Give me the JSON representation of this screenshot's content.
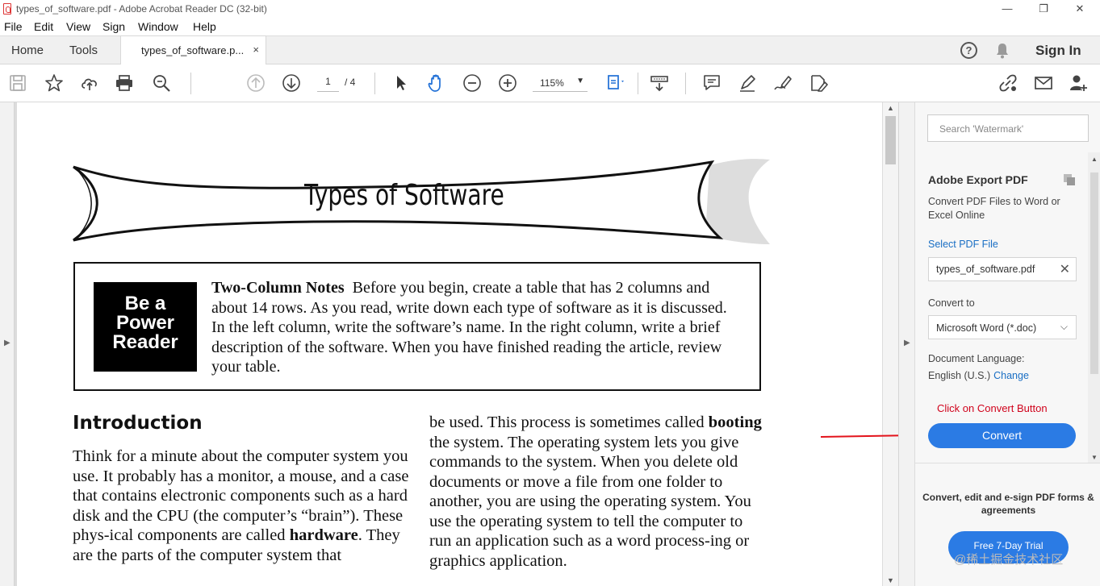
{
  "window": {
    "title": "types_of_software.pdf - Adobe Acrobat Reader DC (32-bit)",
    "minimize": "—",
    "maximize": "❐",
    "close": "✕"
  },
  "menu": [
    "File",
    "Edit",
    "View",
    "Sign",
    "Window",
    "Help"
  ],
  "tabs": {
    "home": "Home",
    "tools": "Tools",
    "document": "types_of_software.p...",
    "close": "×",
    "help": "?",
    "sign_in": "Sign In"
  },
  "toolbar": {
    "page_current": "1",
    "page_total": "/ 4",
    "zoom": "115%",
    "zoom_caret": "▼"
  },
  "document": {
    "banner_title": "Types of Software",
    "badge_lines": [
      "Be a",
      "Power",
      "Reader"
    ],
    "notes_heading": "Two-Column Notes",
    "notes_body": "Before you begin, create a table that has 2 columns and about 14 rows. As you read, write down each type of software as it is discussed. In the left column, write the software’s name. In the right column, write a brief description of the software. When you have finished reading the article, review your table.",
    "intro_heading": "Introduction",
    "left_col_a": "Think for a minute about the computer system you use. It probably has a monitor, a mouse, and a case that contains electronic components such as a hard disk and the CPU (the computer’s “brain”). These phys-ical components are called ",
    "left_col_bold": "hardware",
    "left_col_b": ". They are the parts of the computer system that",
    "right_col_a": "be used. This process is sometimes called ",
    "right_col_bold": "booting",
    "right_col_b": " the system. The operating system lets you give commands to the system. When you delete old documents or move a file from one folder to another, you are using the operating system. You use the operating system to tell the computer to run an application such as a word process-ing or graphics application."
  },
  "right_panel": {
    "search_placeholder": "Search 'Watermark'",
    "export_title": "Adobe Export PDF",
    "export_desc": "Convert PDF Files to Word or Excel Online",
    "select_file": "Select PDF File",
    "file_name": "types_of_software.pdf",
    "file_clear": "✕",
    "convert_to": "Convert to",
    "format": "Microsoft Word (*.doc)",
    "format_caret": "⌵",
    "doc_language": "Document Language:",
    "language": "English (U.S.)",
    "change": "Change",
    "annotation": "Click on Convert Button",
    "convert_button": "Convert",
    "promo": "Convert, edit and e-sign PDF forms & agreements",
    "trial_button": "Free 7-Day Trial",
    "watermark": "@稀土掘金技术社区"
  },
  "colors": {
    "accent": "#2b7be4",
    "link": "#1a6fc4",
    "annotation": "#d0021b"
  }
}
